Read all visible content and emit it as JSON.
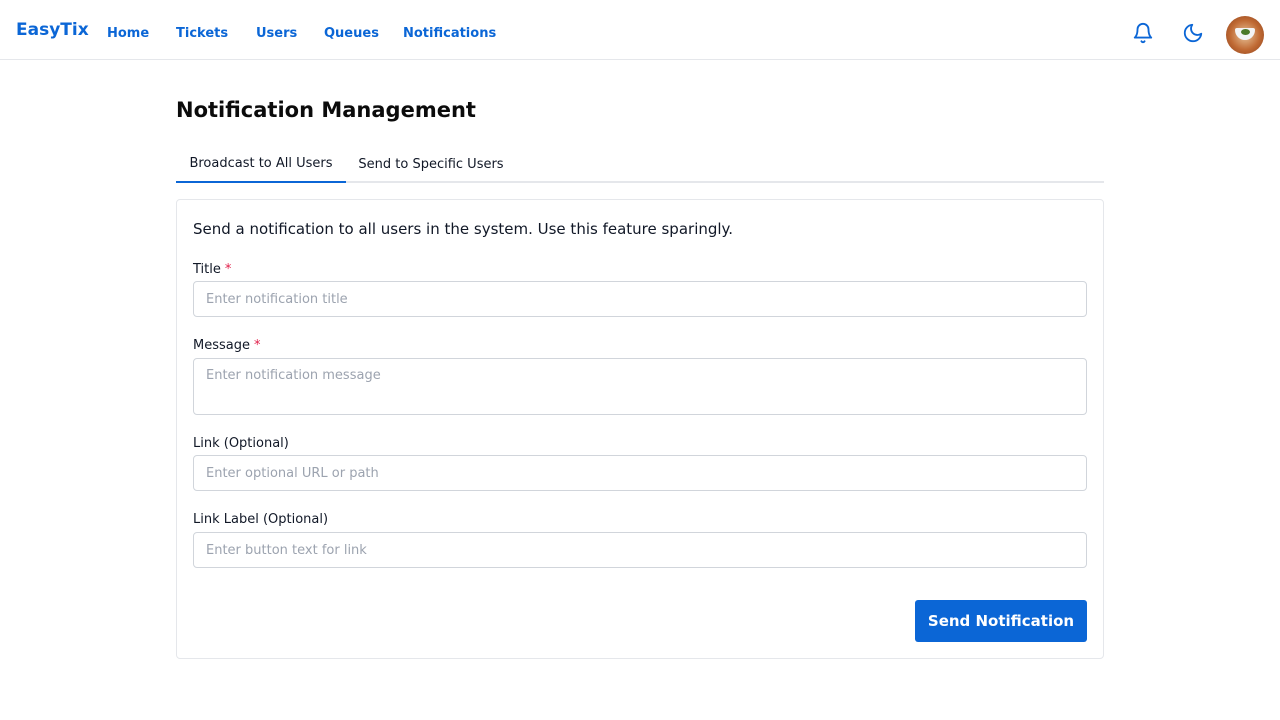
{
  "brand": {
    "name": "EasyTix",
    "accent": "#0b66d6"
  },
  "nav": {
    "items": [
      {
        "label": "Home"
      },
      {
        "label": "Tickets"
      },
      {
        "label": "Users"
      },
      {
        "label": "Queues"
      },
      {
        "label": "Notifications"
      }
    ]
  },
  "header_icons": {
    "notifications": "bell-icon",
    "theme": "moon-icon",
    "avatar": "user-avatar"
  },
  "page": {
    "title": "Notification Management"
  },
  "tabs": [
    {
      "label": "Broadcast to All Users",
      "active": true
    },
    {
      "label": "Send to Specific Users",
      "active": false
    }
  ],
  "form": {
    "description": "Send a notification to all users in the system. Use this feature sparingly.",
    "title_label": "Title",
    "title_placeholder": "Enter notification title",
    "title_value": "",
    "message_label": "Message",
    "message_placeholder": "Enter notification message",
    "message_value": "",
    "link_label": "Link (Optional)",
    "link_placeholder": "Enter optional URL or path",
    "link_value": "",
    "link_text_label": "Link Label (Optional)",
    "link_text_placeholder": "Enter button text for link",
    "link_text_value": "",
    "required_marker": "*",
    "submit_label": "Send Notification"
  }
}
